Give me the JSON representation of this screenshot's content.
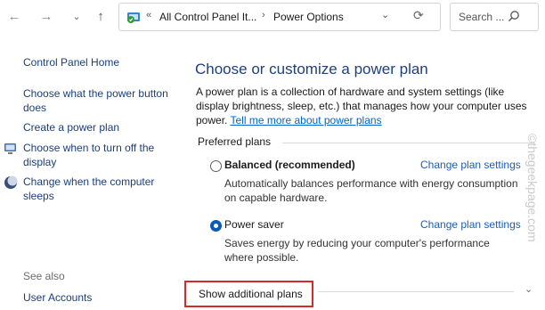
{
  "nav": {
    "back_glyph": "←",
    "forward_glyph": "→",
    "recent_glyph": "⌄",
    "up_glyph": "↑"
  },
  "address": {
    "chevron": "«",
    "crumb1": "All Control Panel It...",
    "separator": "›",
    "crumb2": "Power Options",
    "dropdown_glyph": "⌄",
    "refresh_glyph": "⟳"
  },
  "search": {
    "placeholder": "Search ..."
  },
  "sidebar": {
    "items": [
      {
        "label": "Control Panel Home"
      },
      {
        "label": "Choose what the power button does"
      },
      {
        "label": "Create a power plan"
      },
      {
        "label": "Choose when to turn off the display"
      },
      {
        "label": "Change when the computer sleeps"
      }
    ],
    "see_also": "See also",
    "see_also_items": [
      {
        "label": "User Accounts"
      }
    ]
  },
  "main": {
    "title": "Choose or customize a power plan",
    "description": "A power plan is a collection of hardware and system settings (like display brightness, sleep, etc.) that manages how your computer uses power.",
    "learn_more": "Tell me more about power plans",
    "section_label": "Preferred plans",
    "plans": [
      {
        "name": "Balanced (recommended)",
        "selected": false,
        "description": "Automatically balances performance with energy consumption on capable hardware.",
        "link": "Change plan settings"
      },
      {
        "name": "Power saver",
        "selected": true,
        "description": "Saves energy by reducing your computer's performance where possible.",
        "link": "Change plan settings"
      }
    ],
    "show_additional": "Show additional plans",
    "expand_glyph": "⌄"
  },
  "watermark": "©thegeekpage.com",
  "colors": {
    "title": "#1e3f7e",
    "link": "#1a5fb4",
    "highlight_border": "#d6282f",
    "radio_selected": "#0a5bb5"
  }
}
